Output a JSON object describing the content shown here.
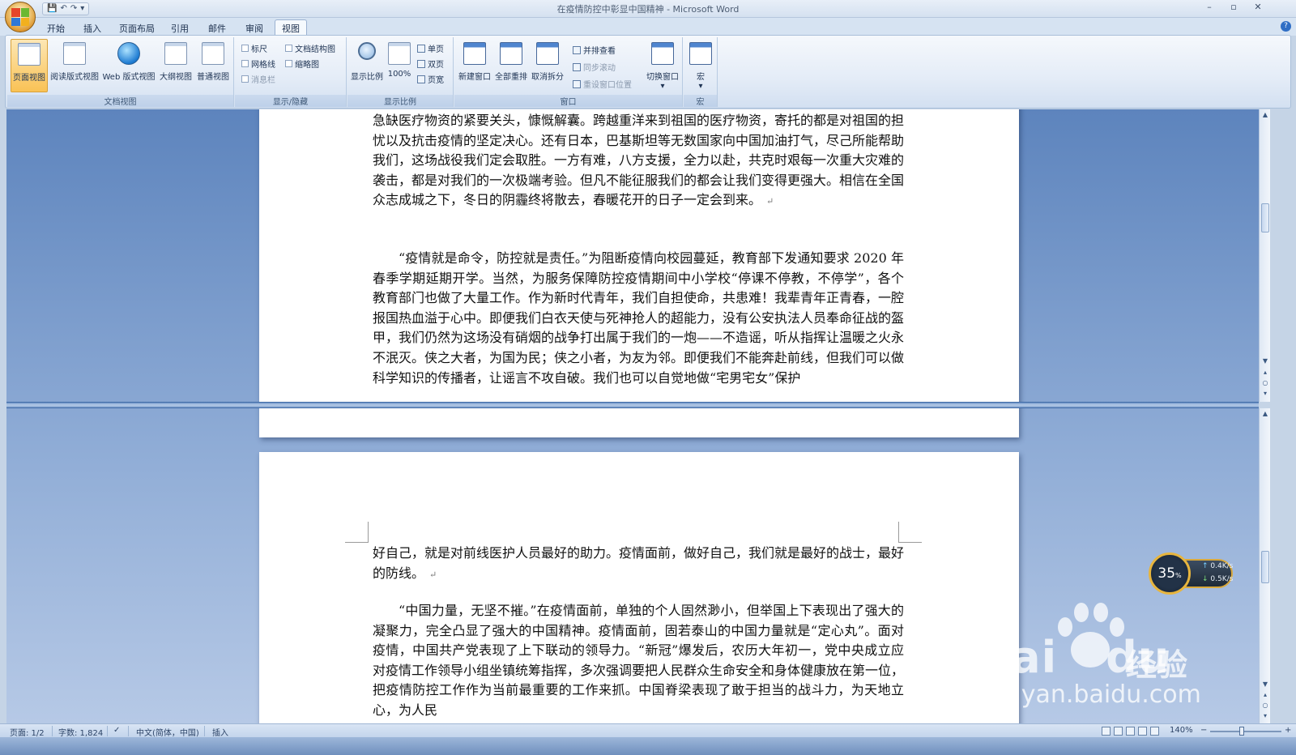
{
  "window": {
    "title": "在疫情防控中彰显中国精神 - Microsoft Word",
    "controls": {
      "minimize": "–",
      "maximize": "▫",
      "close": "✕"
    },
    "qat": {
      "save": "💾",
      "undo": "↶",
      "redo": "↷",
      "more": "▾"
    }
  },
  "tabs": [
    "开始",
    "插入",
    "页面布局",
    "引用",
    "邮件",
    "审阅",
    "视图"
  ],
  "active_tab": "视图",
  "help": "?",
  "ribbon": {
    "doc_views": {
      "label": "文档视图",
      "buttons": [
        "页面视图",
        "阅读版式视图",
        "Web 版式视图",
        "大纲视图",
        "普通视图"
      ]
    },
    "show_hide": {
      "label": "显示/隐藏",
      "checks": [
        "标尺",
        "网格线",
        "消息栏",
        "文档结构图",
        "缩略图"
      ]
    },
    "zoom": {
      "label": "显示比例",
      "zoom_btn": "显示比例",
      "hundred": "100%",
      "one_page": "单页",
      "two_pages": "双页",
      "page_width": "页宽"
    },
    "window": {
      "label": "窗口",
      "new_window": "新建窗口",
      "arrange_all": "全部重排",
      "remove_split": "取消拆分",
      "side_by_side": "并排查看",
      "sync_scroll": "同步滚动",
      "reset_pos": "重设窗口位置",
      "switch_windows": "切换窗口",
      "switch_caret": "▾"
    },
    "macros": {
      "label": "宏",
      "macros_btn": "宏",
      "caret": "▾"
    }
  },
  "document": {
    "top_pane": [
      "急缺医疗物资的紧要关头，慷慨解囊。跨越重洋来到祖国的医疗物资，寄托的都是对祖国的担忧以及抗击疫情的坚定决心。还有日本，巴基斯坦等无数国家向中国加油打气，尽己所能帮助我们，这场战役我们定会取胜。一方有难，八方支援，全力以赴，共克时艰每一次重大灾难的袭击，都是对我们的一次极端考验。但凡不能征服我们的都会让我们变得更强大。相信在全国众志成城之下，冬日的阴霾终将散去，春暖花开的日子一定会到来。",
      "“疫情就是命令，防控就是责任。”为阻断疫情向校园蔓延，教育部下发通知要求 2020 年春季学期延期开学。当然，为服务保障防控疫情期间中小学校“停课不停教，不停学”，各个教育部门也做了大量工作。作为新时代青年，我们自担使命，共患难！我辈青年正青春，一腔报国热血溢于心中。即便我们白衣天使与死神抢人的超能力，没有公安执法人员奉命征战的盔甲，我们仍然为这场没有硝烟的战争打出属于我们的一炮——不造谣，听从指挥让温暖之火永不泯灭。侠之大者，为国为民；侠之小者，为友为邻。即便我们不能奔赴前线，但我们可以做科学知识的传播者，让谣言不攻自破。我们也可以自觉地做“宅男宅女”保护"
    ],
    "bottom_pane": [
      "好自己，就是对前线医护人员最好的助力。疫情面前，做好自己，我们就是最好的战士，最好的防线。",
      "“中国力量，无坚不摧。”在疫情面前，单独的个人固然渺小，但举国上下表现出了强大的凝聚力，完全凸显了强大的中国精神。疫情面前，固若泰山的中国力量就是“定心丸”。面对疫情，中国共产党表现了上下联动的领导力。“新冠”爆发后，农历大年初一，党中央成立应对疫情工作领导小组坐镇统筹指挥，多次强调要把人民群众生命安全和身体健康放在第一位，把疫情防控工作作为当前最重要的工作来抓。中国脊梁表现了敢于担当的战斗力，为天地立心，为人民"
    ],
    "para_mark": "↵"
  },
  "status": {
    "page": "页面: 1/2",
    "words": "字数: 1,824",
    "proof_icon": "✓",
    "language": "中文(简体，中国)",
    "mode": "插入",
    "zoom": "140%",
    "zoom_minus": "−",
    "zoom_plus": "+"
  },
  "scroll": {
    "up": "▲",
    "down": "▼",
    "prev": "▴",
    "select": "○",
    "next": "▾"
  },
  "net_widget": {
    "percent": "35",
    "percent_unit": "%",
    "up": "0.4K/s",
    "down": "0.5K/s",
    "up_arrow": "↑",
    "down_arrow": "↓"
  },
  "watermark": {
    "brand": "Bai",
    "brand2": "du",
    "cn": "经验",
    "url": "jingyan.baidu.com"
  },
  "colors": {
    "accent": "#f9c255",
    "ribbon_border": "#a9bfd9",
    "doc_bg": "#5d84bd"
  }
}
